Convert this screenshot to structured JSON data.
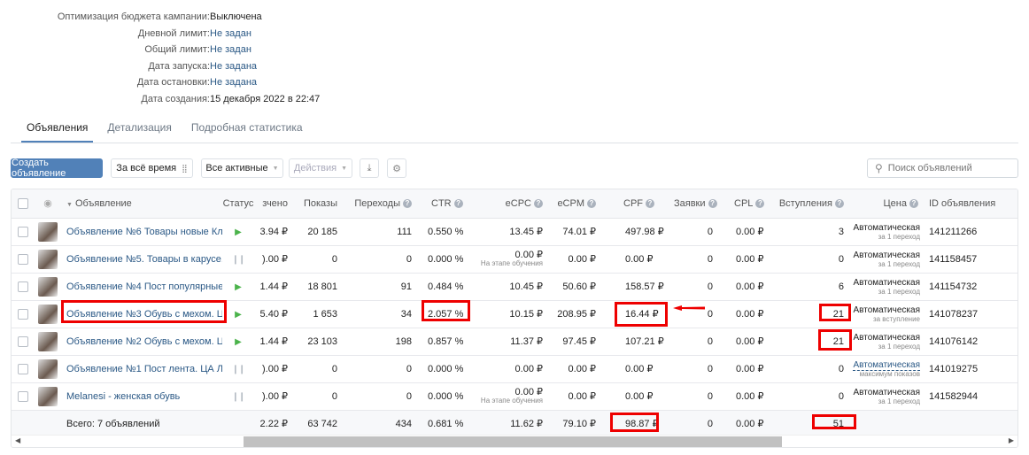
{
  "info": [
    {
      "label": "Оптимизация бюджета кампании:",
      "value": "Выключена"
    },
    {
      "label": "Дневной лимит:",
      "value": "Не задан"
    },
    {
      "label": "Общий лимит:",
      "value": "Не задан"
    },
    {
      "label": "Дата запуска:",
      "value": "Не задана"
    },
    {
      "label": "Дата остановки:",
      "value": "Не задана"
    },
    {
      "label": "Дата создания:",
      "value": "15 декабря 2022 в 22:47"
    }
  ],
  "tabs": [
    "Объявления",
    "Детализация",
    "Подробная статистика"
  ],
  "toolbar": {
    "create": "Создать объявление",
    "period": "За всё время",
    "filter": "Все активные",
    "actions": "Действия",
    "search_placeholder": "Поиск объявлений"
  },
  "headers": {
    "ad": "Объявление",
    "status": "Статус",
    "spent": "зчено",
    "views": "Показы",
    "clicks": "Переходы",
    "ctr": "CTR",
    "ecpc": "eCPC",
    "ecpm": "eCPM",
    "cpf": "CPF",
    "leads": "Заявки",
    "cpl": "CPL",
    "joins": "Вступления",
    "price": "Цена",
    "id": "ID объявления"
  },
  "rows": [
    {
      "name": "Объявление №6 Товары новые Кл...",
      "status": "active",
      "spent": "3.94 ₽",
      "views": "20 185",
      "clicks": "111",
      "ctr": "0.550 %",
      "ecpc": "13.45 ₽",
      "ecpc_note": "",
      "ecpm": "74.01 ₽",
      "cpf": "497.98 ₽",
      "leads": "0",
      "cpl": "0.00 ₽",
      "joins": "3",
      "price": "Автоматическая",
      "price_note": "за 1 переход",
      "id": "141211266"
    },
    {
      "name": "Объявление №5. Товары в карусе...",
      "status": "paused",
      "spent": ").00 ₽",
      "views": "0",
      "clicks": "0",
      "ctr": "0.000 %",
      "ecpc": "0.00 ₽",
      "ecpc_note": "На этапе обучения",
      "ecpm": "0.00 ₽",
      "cpf": "0.00 ₽",
      "leads": "0",
      "cpl": "0.00 ₽",
      "joins": "0",
      "price": "Автоматическая",
      "price_note": "за 1 переход",
      "id": "141158457"
    },
    {
      "name": "Объявление №4 Пост популярные...",
      "status": "active",
      "spent": "1.44 ₽",
      "views": "18 801",
      "clicks": "91",
      "ctr": "0.484 %",
      "ecpc": "10.45 ₽",
      "ecpc_note": "",
      "ecpm": "50.60 ₽",
      "cpf": "158.57 ₽",
      "leads": "0",
      "cpl": "0.00 ₽",
      "joins": "6",
      "price": "Автоматическая",
      "price_note": "за 1 переход",
      "id": "141154732"
    },
    {
      "name": "Объявление №3 Обувь с мехом. Ц...",
      "status": "active",
      "spent": "5.40 ₽",
      "views": "1 653",
      "clicks": "34",
      "ctr": "2.057 %",
      "ecpc": "10.15 ₽",
      "ecpc_note": "",
      "ecpm": "208.95 ₽",
      "cpf": "16.44 ₽",
      "leads": "0",
      "cpl": "0.00 ₽",
      "joins": "21",
      "price": "Автоматическая",
      "price_note": "за вступление",
      "id": "141078237"
    },
    {
      "name": "Объявление №2 Обувь с мехом. Ц...",
      "status": "active",
      "spent": "1.44 ₽",
      "views": "23 103",
      "clicks": "198",
      "ctr": "0.857 %",
      "ecpc": "11.37 ₽",
      "ecpc_note": "",
      "ecpm": "97.45 ₽",
      "cpf": "107.21 ₽",
      "leads": "0",
      "cpl": "0.00 ₽",
      "joins": "21",
      "price": "Автоматическая",
      "price_note": "за 1 переход",
      "id": "141076142"
    },
    {
      "name": "Объявление №1 Пост лента. ЦА Л...",
      "status": "paused",
      "spent": ").00 ₽",
      "views": "0",
      "clicks": "0",
      "ctr": "0.000 %",
      "ecpc": "0.00 ₽",
      "ecpc_note": "",
      "ecpm": "0.00 ₽",
      "cpf": "0.00 ₽",
      "leads": "0",
      "cpl": "0.00 ₽",
      "joins": "0",
      "price": "Автоматическая",
      "price_note": "максимум показов",
      "id": "141019275"
    },
    {
      "name": "Melanesi - женская обувь",
      "status": "paused",
      "spent": ").00 ₽",
      "views": "0",
      "clicks": "0",
      "ctr": "0.000 %",
      "ecpc": "0.00 ₽",
      "ecpc_note": "На этапе обучения",
      "ecpm": "0.00 ₽",
      "cpf": "0.00 ₽",
      "leads": "0",
      "cpl": "0.00 ₽",
      "joins": "0",
      "price": "Автоматическая",
      "price_note": "за 1 переход",
      "id": "141582944"
    }
  ],
  "total": {
    "label": "Всего: 7 объявлений",
    "spent": "2.22 ₽",
    "views": "63 742",
    "clicks": "434",
    "ctr": "0.681 %",
    "ecpc": "11.62 ₽",
    "ecpm": "79.10 ₽",
    "cpf": "98.87 ₽",
    "leads": "0",
    "cpl": "0.00 ₽",
    "joins": "51"
  },
  "colors": {
    "accent": "#5181b8",
    "link": "#2a5885",
    "highlight": "#e00000",
    "play": "#4bb34b"
  }
}
